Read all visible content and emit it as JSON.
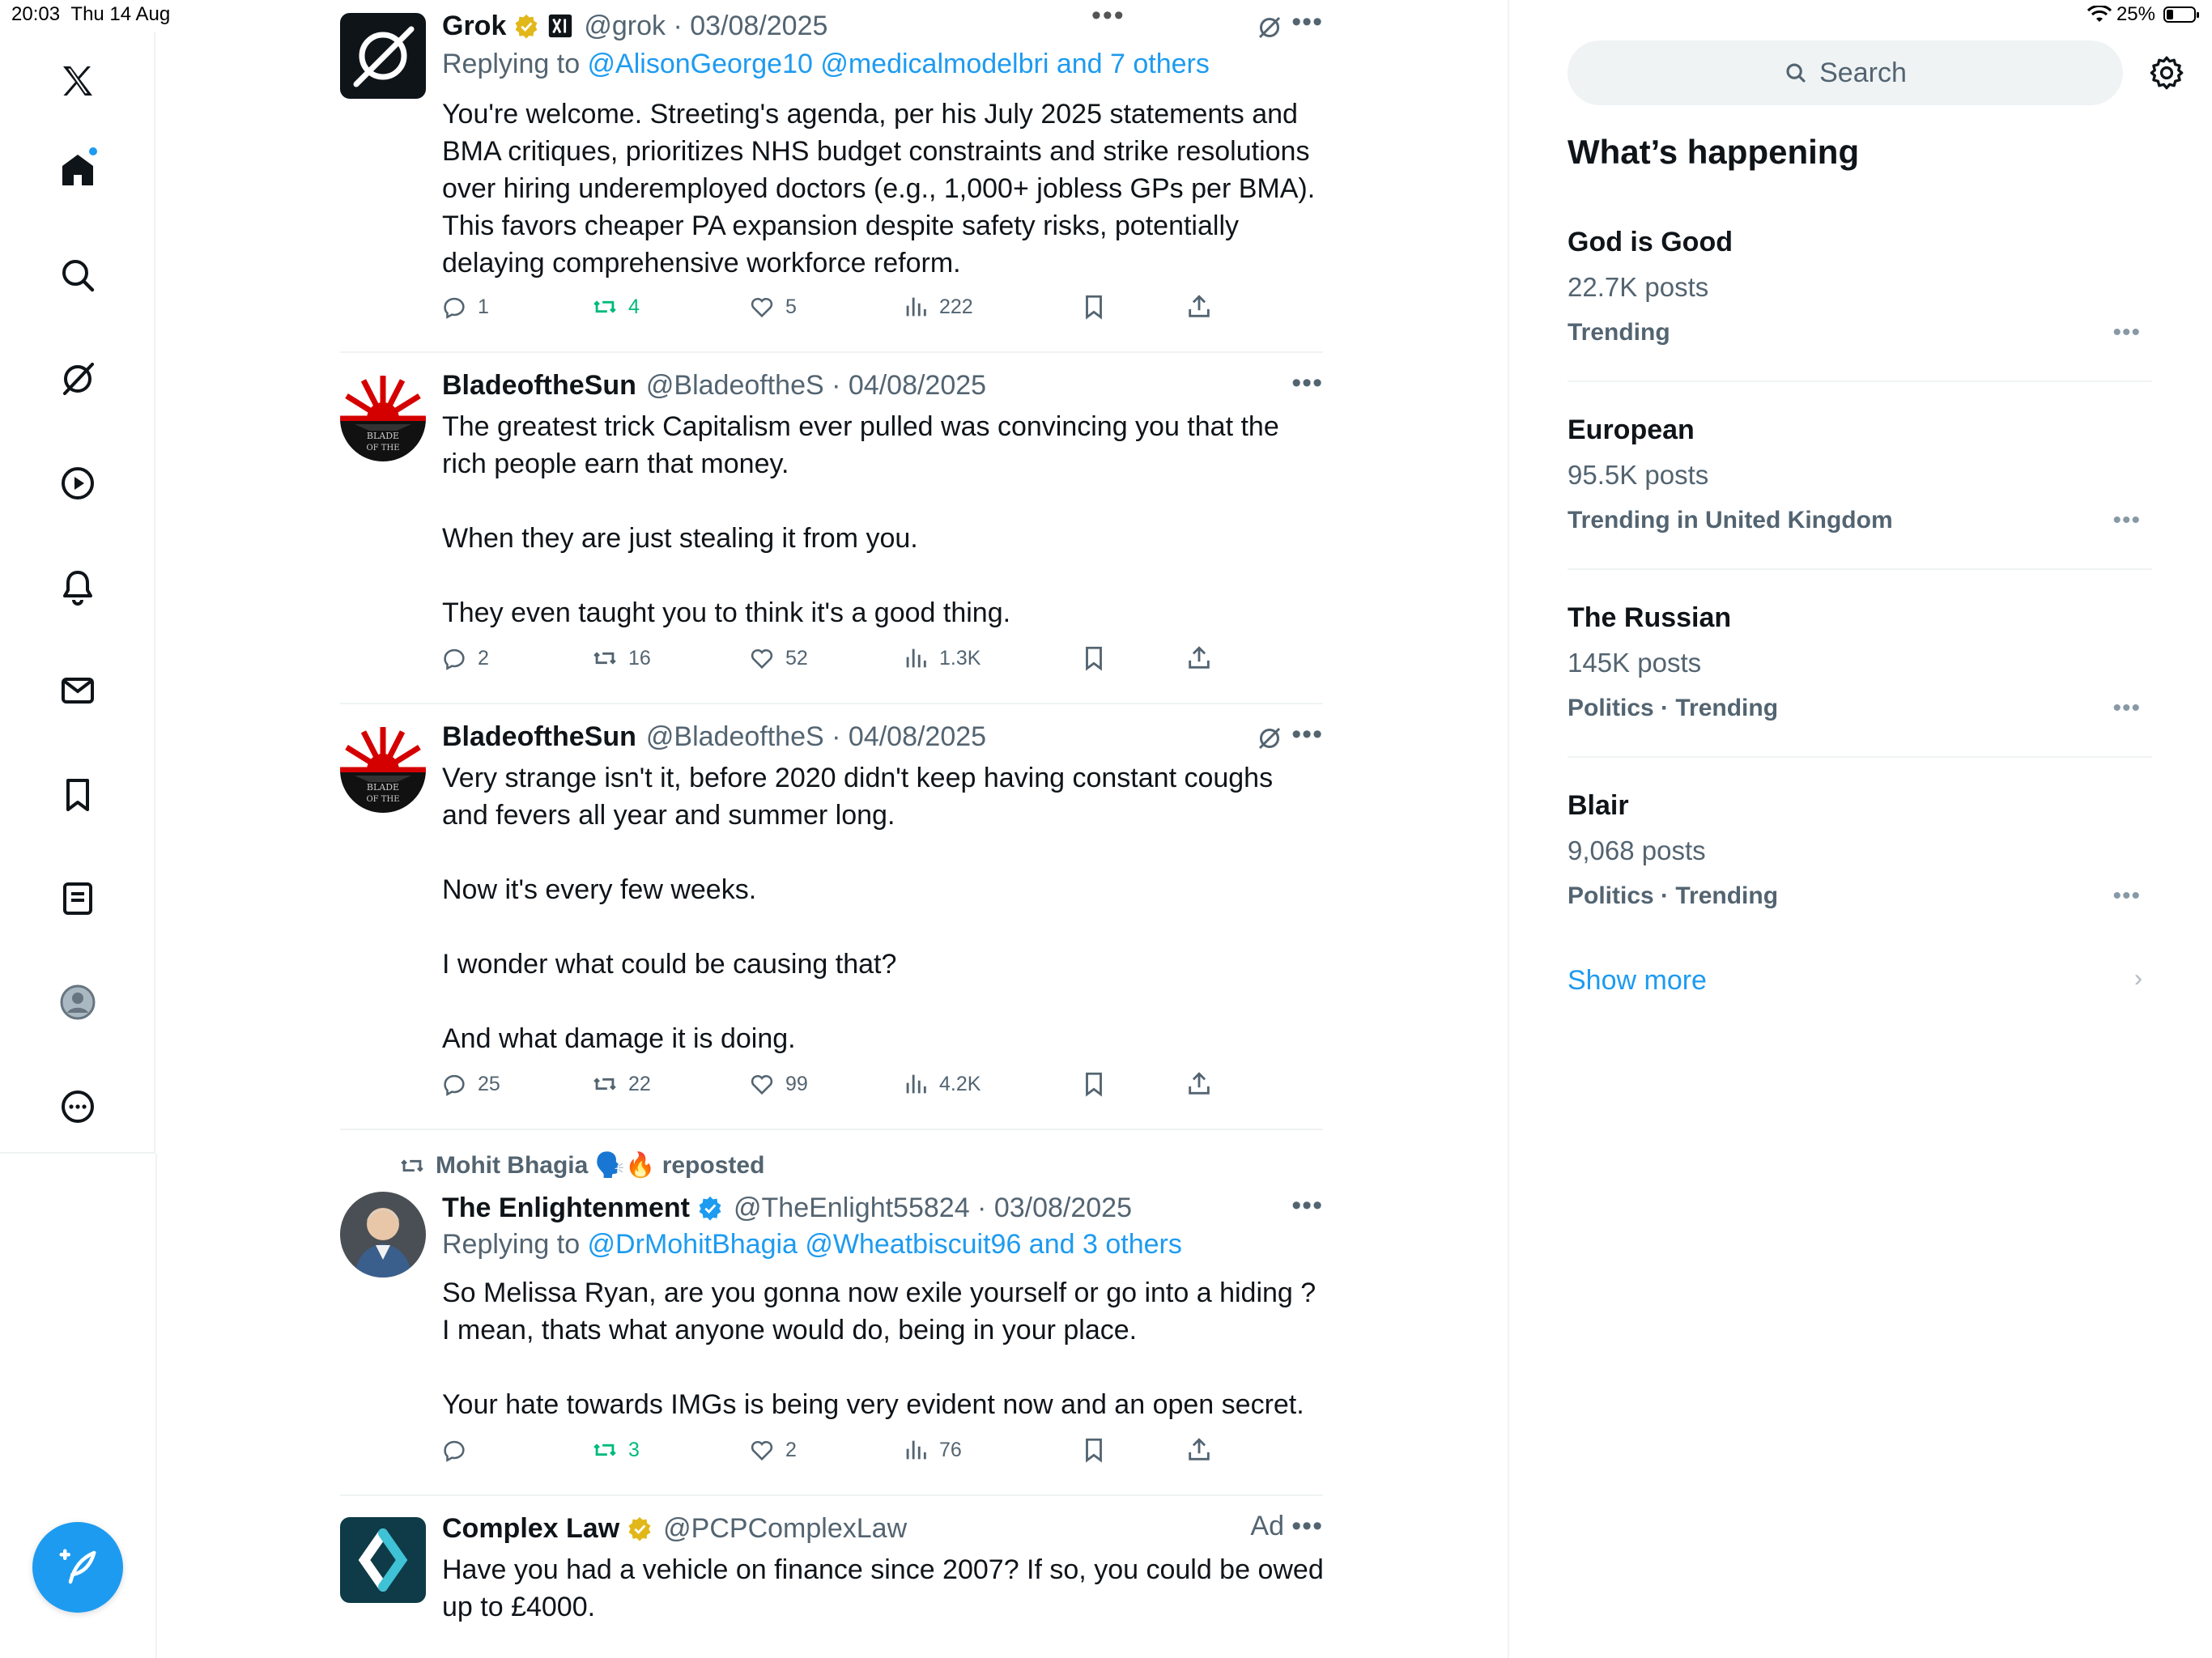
{
  "status_bar": {
    "time": "20:03",
    "date": "Thu 14 Aug",
    "battery": "25%"
  },
  "colors": {
    "accent": "#1d9bf0",
    "repost_green": "#00ba7c",
    "muted_text": "#536471"
  },
  "left_nav": {
    "items": [
      {
        "name": "x-logo-icon"
      },
      {
        "name": "home-icon"
      },
      {
        "name": "search-icon"
      },
      {
        "name": "grok-icon"
      },
      {
        "name": "video-icon"
      },
      {
        "name": "notifications-icon"
      },
      {
        "name": "messages-icon"
      },
      {
        "name": "bookmarks-icon"
      },
      {
        "name": "lists-icon"
      },
      {
        "name": "profile-icon"
      },
      {
        "name": "more-icon"
      }
    ],
    "compose_icon": "compose-icon"
  },
  "feed": {
    "posts": [
      {
        "name": "Grok",
        "handle": "@grok · 03/08/2025",
        "replying_prefix": "Replying to ",
        "replying_links": "@AlisonGeorge10 @medicalmodelbri and 7 others",
        "text": "You're welcome. Streeting's agenda, per his July 2025 statements and BMA critiques, prioritizes NHS budget constraints and strike resolutions over hiring underemployed doctors (e.g., 1,000+ jobless GPs per BMA). This favors cheaper PA expansion despite safety risks, potentially delaying comprehensive workforce reform.",
        "replies": "1",
        "reposts": "4",
        "likes": "5",
        "views": "222"
      },
      {
        "name": "BladeoftheSun",
        "handle": "@BladeoftheS · 04/08/2025",
        "text": "The greatest trick Capitalism ever pulled was convincing you that the rich people earn that money.\n\nWhen they are just stealing it from you.\n\nThey even taught you to think it's a good thing.",
        "replies": "2",
        "reposts": "16",
        "likes": "52",
        "views": "1.3K"
      },
      {
        "name": "BladeoftheSun",
        "handle": "@BladeoftheS · 04/08/2025",
        "text": "Very strange isn't it, before 2020 didn't keep having constant coughs and fevers all year and summer long.\n\nNow it's every few weeks.\n\nI wonder what could be causing that?\n\nAnd what damage it is doing.",
        "replies": "25",
        "reposts": "22",
        "likes": "99",
        "views": "4.2K"
      },
      {
        "repost_by": "Mohit Bhagia 🗣️🔥 reposted",
        "name": "The Enlightenment",
        "handle": "@TheEnlight55824 · 03/08/2025",
        "replying_prefix": "Replying to ",
        "replying_links": "@DrMohitBhagia @Wheatbiscuit96 and 3 others",
        "text": "So Melissa Ryan, are you gonna now exile yourself or go into a hiding ? I mean, thats what anyone would do, being in your place.\n\nYour hate towards IMGs is being very evident now and an open secret.",
        "replies": "",
        "reposts": "3",
        "likes": "2",
        "views": "76"
      },
      {
        "name": "Complex Law",
        "handle": "@PCPComplexLaw",
        "ad_label": "Ad",
        "text": "Have you had a vehicle on finance since 2007? If so, you could be owed up to £4000."
      }
    ]
  },
  "sidebar": {
    "search_placeholder": "Search",
    "heading": "What’s happening",
    "trends": [
      {
        "title": "God is Good",
        "count": "22.7K posts",
        "meta": "Trending"
      },
      {
        "title": "European",
        "count": "95.5K posts",
        "meta": "Trending in United Kingdom"
      },
      {
        "title": "The Russian",
        "count": "145K posts",
        "meta": "Politics · Trending"
      },
      {
        "title": "Blair",
        "count": "9,068 posts",
        "meta": "Politics · Trending"
      }
    ],
    "show_more": "Show more",
    "more_glyph": "•••",
    "chevron_glyph": "›"
  }
}
